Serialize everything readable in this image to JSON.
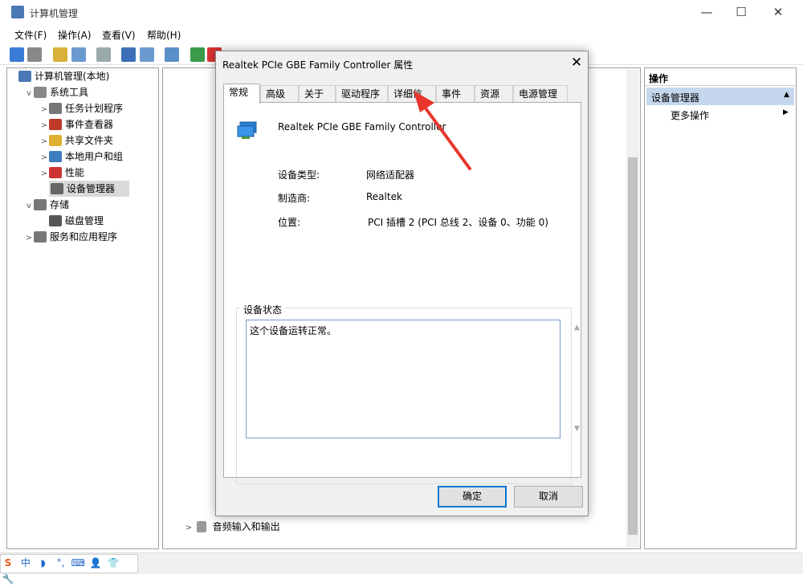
{
  "window": {
    "title": "计算机管理",
    "minimize": "—",
    "maximize": "☐",
    "close": "✕"
  },
  "menu": [
    "文件(F)",
    "操作(A)",
    "查看(V)",
    "帮助(H)"
  ],
  "left_tree": [
    {
      "label": "计算机管理(本地)",
      "indent": 0,
      "chevron": "",
      "icon_color": "#4a78b5"
    },
    {
      "label": "系统工具",
      "indent": 1,
      "chevron": "v",
      "icon_color": "#888888"
    },
    {
      "label": "任务计划程序",
      "indent": 2,
      "chevron": ">",
      "icon_color": "#777777"
    },
    {
      "label": "事件查看器",
      "indent": 2,
      "chevron": ">",
      "icon_color": "#c0392b"
    },
    {
      "label": "共享文件夹",
      "indent": 2,
      "chevron": ">",
      "icon_color": "#e0b030"
    },
    {
      "label": "本地用户和组",
      "indent": 2,
      "chevron": ">",
      "icon_color": "#3e7bbf"
    },
    {
      "label": "性能",
      "indent": 2,
      "chevron": ">",
      "icon_color": "#cc3333"
    },
    {
      "label": "设备管理器",
      "indent": 2,
      "chevron": "",
      "icon_color": "#666666",
      "selected": true
    },
    {
      "label": "存储",
      "indent": 1,
      "chevron": "v",
      "icon_color": "#777777"
    },
    {
      "label": "磁盘管理",
      "indent": 2,
      "chevron": "",
      "icon_color": "#555555"
    },
    {
      "label": "服务和应用程序",
      "indent": 1,
      "chevron": ">",
      "icon_color": "#777777"
    }
  ],
  "mid_last_item": "音频输入和输出",
  "right_pane": {
    "header": "操作",
    "selected": "设备管理器",
    "more": "更多操作"
  },
  "dialog": {
    "title": "Realtek PCIe GBE Family Controller 属性",
    "close": "✕",
    "tabs": [
      "常规",
      "高级",
      "关于",
      "驱动程序",
      "详细信息",
      "事件",
      "资源",
      "电源管理"
    ],
    "active_tab": "常规",
    "device_name": "Realtek PCIe GBE Family Controller",
    "fields": [
      {
        "key": "设备类型:",
        "value": "网络适配器"
      },
      {
        "key": "制造商:",
        "value": "Realtek"
      },
      {
        "key": "位置:",
        "value": "PCI 插槽 2 (PCI 总线 2、设备 0、功能 0)"
      }
    ],
    "status_group": "设备状态",
    "status_text": "这个设备运转正常。",
    "ok": "确定",
    "cancel": "取消"
  },
  "ime": [
    "中",
    "◗",
    "°,",
    "⌨",
    "👤",
    "👕",
    "🔧"
  ],
  "colors": {
    "accent": "#0078d7",
    "selected_bg": "#c5d7ec",
    "arrow": "#e8362c"
  }
}
